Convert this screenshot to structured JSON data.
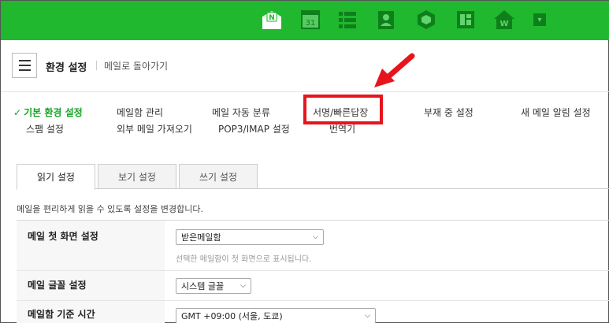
{
  "apps": [
    {
      "name": "mail-icon",
      "label": "N"
    },
    {
      "name": "calendar-icon",
      "label": "31"
    },
    {
      "name": "list-icon",
      "label": ""
    },
    {
      "name": "contacts-icon",
      "label": ""
    },
    {
      "name": "box-icon",
      "label": ""
    },
    {
      "name": "memo-icon",
      "label": ""
    },
    {
      "name": "home-icon",
      "label": "W"
    },
    {
      "name": "dropdown-icon",
      "label": "▾"
    }
  ],
  "header": {
    "title": "환경 설정",
    "back_link": "메일로 돌아가기"
  },
  "nav": {
    "check_mark": "✓",
    "items": [
      "기본 환경 설정",
      "메일함 관리",
      "메일 자동 분류",
      "서명/빠른답장",
      "부재 중 설정",
      "새 메일 알림 설정",
      "스팸 설정",
      "외부 메일 가져오기",
      "POP3/IMAP 설정",
      "번역기"
    ]
  },
  "tabs": [
    "읽기 설정",
    "보기 설정",
    "쓰기 설정"
  ],
  "description": "메일을 편리하게 읽을 수 있도록 설정을 변경합니다.",
  "rows": [
    {
      "label": "메일 첫 화면 설정",
      "value": "받은메일함",
      "hint": "선택한 메일함이 첫 화면으로 표시됩니다."
    },
    {
      "label": "메일 글꼴 설정",
      "value": "시스템 글꼴"
    },
    {
      "label": "메일함 기준 시간",
      "value": "GMT +09:00 (서울, 도쿄)"
    }
  ],
  "colors": {
    "brand": "#1fb82e",
    "highlight": "#e8141b",
    "active": "#14a324"
  }
}
